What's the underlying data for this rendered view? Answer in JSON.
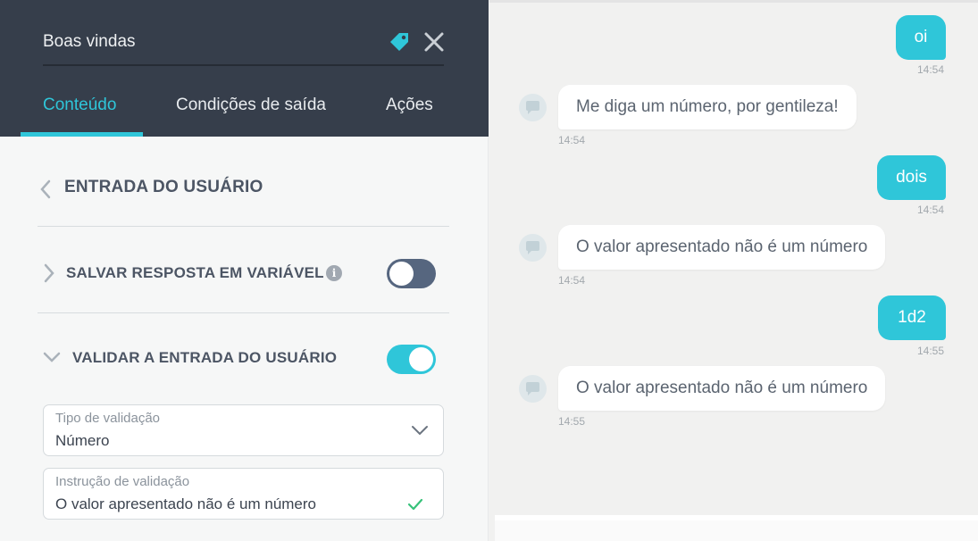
{
  "editor": {
    "title": "Boas vindas",
    "tabs": [
      "Conteúdo",
      "Condições de saída",
      "Ações"
    ],
    "section_title": "ENTRADA DO USUÁRIO",
    "save_response": {
      "label": "SALVAR RESPOSTA EM VARIÁVEL",
      "info_glyph": "i",
      "enabled": false
    },
    "validate_input": {
      "label": "VALIDAR A ENTRADA DO USUÁRIO",
      "enabled": true
    },
    "validation_type": {
      "label": "Tipo de validação",
      "value": "Número"
    },
    "validation_instruction": {
      "label": "Instrução de validação",
      "value": "O valor apresentado não é um número"
    }
  },
  "chat": {
    "messages": [
      {
        "from": "user",
        "text": "oi",
        "time": "14:54"
      },
      {
        "from": "bot",
        "text": "Me diga um número, por gentileza!",
        "time": "14:54"
      },
      {
        "from": "user",
        "text": "dois",
        "time": "14:54"
      },
      {
        "from": "bot",
        "text": "O valor apresentado não é um número",
        "time": "14:54"
      },
      {
        "from": "user",
        "text": "1d2",
        "time": "14:55"
      },
      {
        "from": "bot",
        "text": "O valor apresentado não é um número",
        "time": "14:55"
      }
    ]
  },
  "colors": {
    "accent": "#2fc6d9",
    "header": "#363e4b",
    "toggle_off": "#56667f"
  },
  "icons": {
    "tag": "tag-icon",
    "close": "close-icon",
    "back": "chevron-left-icon",
    "collapsed": "chevron-right-icon",
    "expanded": "chevron-down-icon",
    "select": "chevron-down-icon",
    "valid": "check-icon",
    "bot": "chat-bubble-icon"
  }
}
